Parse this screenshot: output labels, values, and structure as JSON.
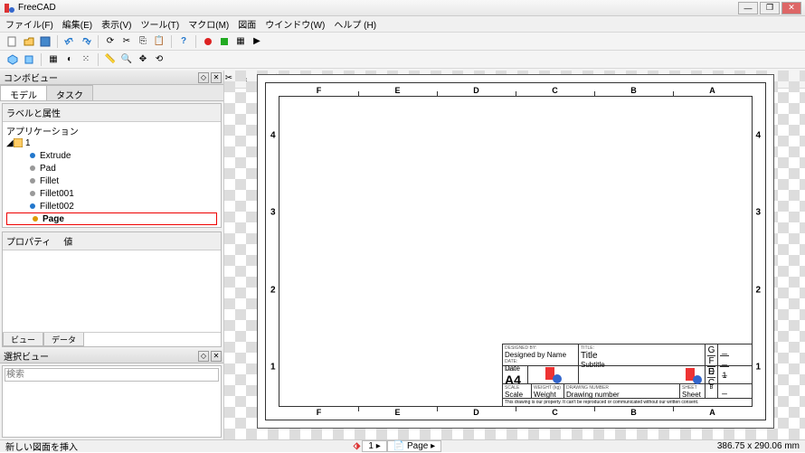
{
  "window": {
    "title": "FreeCAD"
  },
  "menu": {
    "file": "ファイル(F)",
    "edit": "編集(E)",
    "view": "表示(V)",
    "tools": "ツール(T)",
    "macro": "マクロ(M)",
    "drawing": "図面",
    "window": "ウインドウ(W)",
    "help": "ヘルプ (H)"
  },
  "workbench": {
    "selected": "Drawing"
  },
  "panels": {
    "combo_title": "コンボビュー",
    "tab_model": "モデル",
    "tab_tasks": "タスク",
    "labels_header": "ラベルと属性",
    "application": "アプリケーション",
    "property": "プロパティ",
    "value": "値",
    "view_tab": "ビュー",
    "data_tab": "データ",
    "selection_title": "選択ビュー",
    "search": "検索"
  },
  "tree": {
    "doc": "1",
    "items": [
      {
        "label": "Extrude",
        "color": "#27c"
      },
      {
        "label": "Pad",
        "color": "#999"
      },
      {
        "label": "Fillet",
        "color": "#999"
      },
      {
        "label": "Fillet001",
        "color": "#999"
      },
      {
        "label": "Fillet002",
        "color": "#27c"
      },
      {
        "label": "Page",
        "color": "#d90",
        "selected": true
      }
    ]
  },
  "drawing": {
    "cols": [
      "F",
      "E",
      "D",
      "C",
      "B",
      "A"
    ],
    "rows": [
      "4",
      "3",
      "2",
      "1"
    ],
    "title_block": {
      "designed_by_label": "DESIGNED BY:",
      "designed_by": "Designed by Name",
      "date_label": "DATE:",
      "date": "Date",
      "title_label": "TITLE:",
      "title": "Title",
      "subtitle": "Subtitle",
      "size_label": "SIZE",
      "size": "A4",
      "scale_label": "SCALE",
      "scale": "Scale",
      "weight_label": "WEIGHT (kg)",
      "weight": "Weight",
      "drawing_no_label": "DRAWING NUMBER",
      "drawing_no": "Drawing number",
      "sheet_label": "SHEET",
      "sheet": "Sheet",
      "rev_label": "REV",
      "rev_g": "G",
      "rev_f": "F",
      "rev_e": "E",
      "rev_d": "D",
      "rev_c": "C",
      "rev_b": "B",
      "rev_row_num": "1",
      "disclaimer": "This drawing is our property. It can't be reproduced or communicated without our written consent."
    }
  },
  "status": {
    "left": "新しい図面を挿入",
    "doc_icon": "1",
    "page_tab": "Page",
    "coords": "386.75 x 290.06 mm"
  }
}
